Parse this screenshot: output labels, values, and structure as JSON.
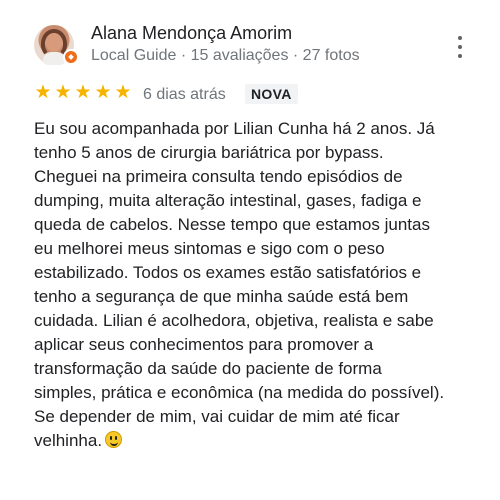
{
  "review": {
    "reviewer": {
      "name": "Alana Mendonça Amorim",
      "meta": "Local Guide · 15 avaliações · 27 fotos",
      "avatar_icon": "profile-photo-icon",
      "badge_icon": "local-guide-badge-icon"
    },
    "rating": {
      "stars": 5,
      "star_glyph": "★",
      "time": "6 dias atrás",
      "badge": "NOVA"
    },
    "text_lines": [
      "Eu sou acompanhada por Lilian Cunha há 2 anos. Já",
      "tenho 5 anos de cirurgia bariátrica por bypass.",
      "Cheguei na primeira consulta tendo episódios de",
      "dumping, muita alteração intestinal, gases, fadiga e",
      "queda de cabelos. Nesse tempo que estamos juntas",
      "eu melhorei meus sintomas e sigo com o peso",
      "estabilizado. Todos os exames estão satisfatórios e",
      "tenho a segurança de que minha saúde está bem",
      "cuidada. Lilian é acolhedora, objetiva, realista e sabe",
      "aplicar seus conhecimentos para promover a",
      "transformação da saúde do paciente de forma",
      "simples, prática e econômica (na medida do possível).",
      "Se depender de mim, vai cuidar de mim até ficar",
      "velhinha."
    ],
    "emoji_icon": "grinning-face-emoji-icon",
    "more_icon": "more-vertical-icon"
  },
  "colors": {
    "star": "#f4b400",
    "secondary_text": "#70757a",
    "primary_text": "#202124",
    "badge_background": "#f1f3f4"
  }
}
